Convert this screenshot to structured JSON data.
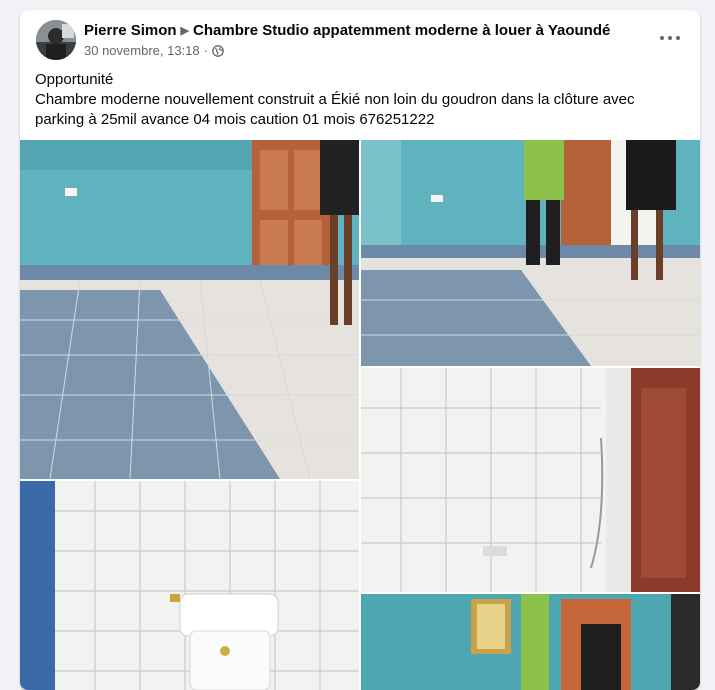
{
  "post": {
    "author": "Pierre Simon",
    "group": "Chambre Studio appatemment moderne à louer à Yaoundé",
    "timestamp": "30 novembre, 13:18",
    "audience_icon": "globe-icon",
    "text_line1": "Opportunité",
    "text_line2": "Chambre moderne nouvellement construit a Ékié non loin du goudron dans la clôture avec parking à 25mil avance 04 mois caution 01 mois 676251222"
  },
  "colors": {
    "wall_blue": "#5fb3bf",
    "floor_tile": "#e6e3df",
    "door_wood": "#b5623a",
    "text_secondary": "#65676b"
  },
  "photos": [
    {
      "name": "photo-room-floor-1"
    },
    {
      "name": "photo-room-floor-2"
    },
    {
      "name": "photo-bathroom-wall"
    },
    {
      "name": "photo-toilet"
    },
    {
      "name": "photo-room-window"
    }
  ]
}
